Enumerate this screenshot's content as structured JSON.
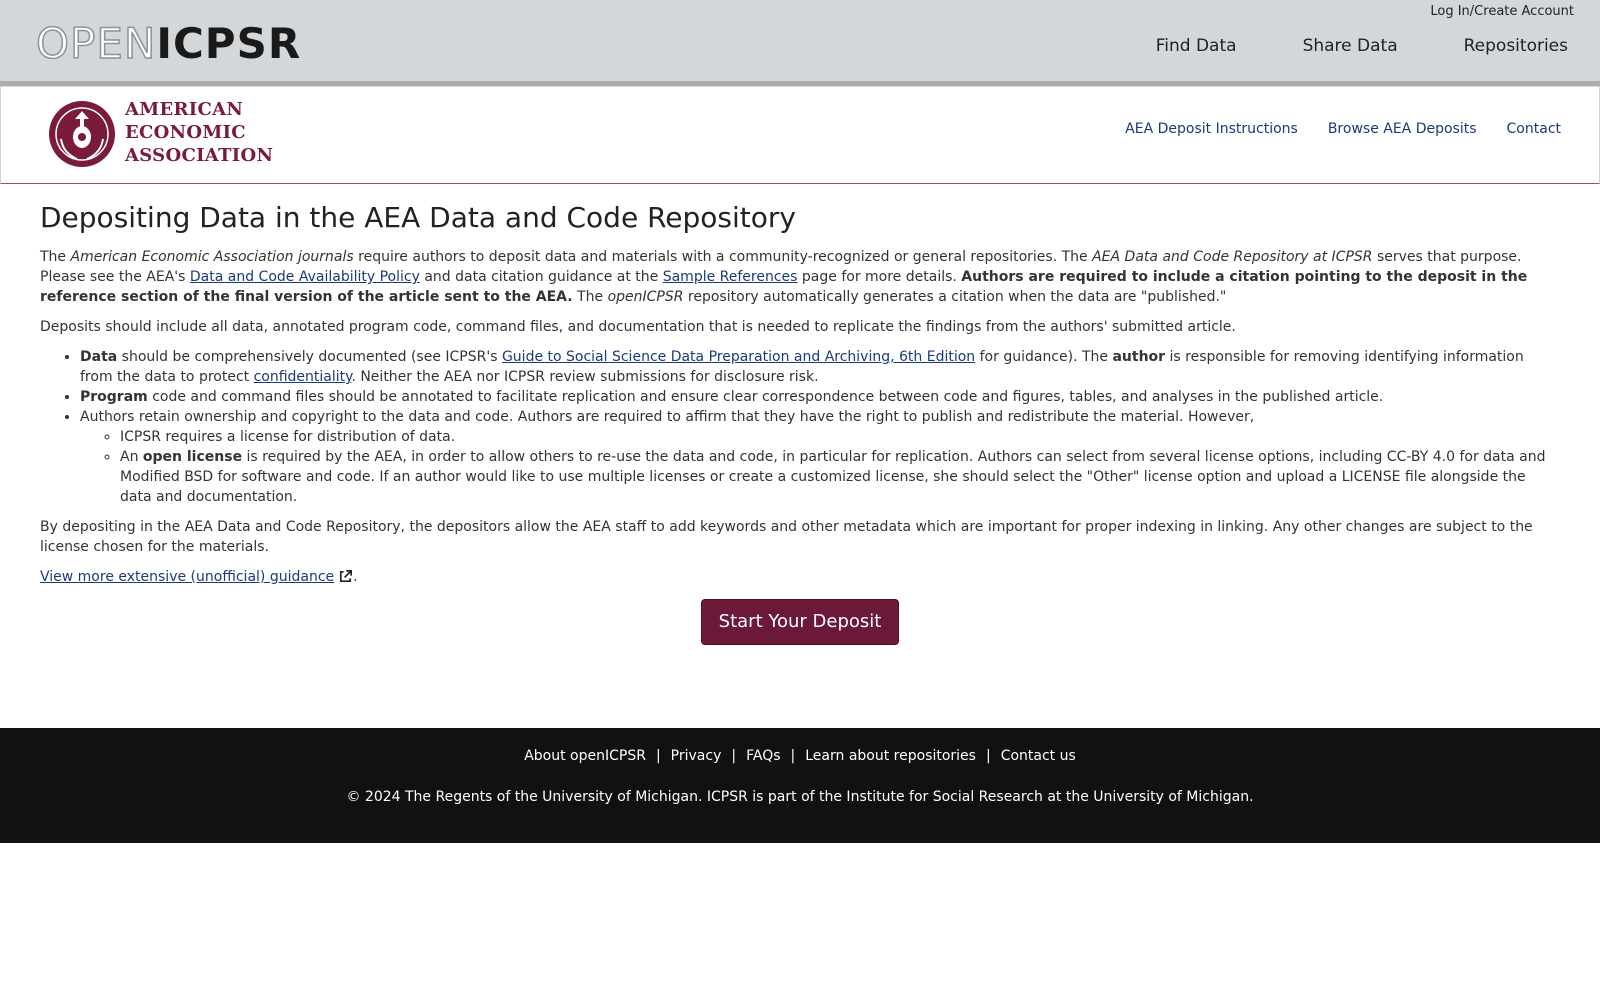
{
  "header": {
    "brand_open": "OPEN",
    "brand_icpsr": "ICPSR",
    "login": "Log In/Create Account",
    "nav": [
      "Find Data",
      "Share Data",
      "Repositories"
    ]
  },
  "aea": {
    "name_lines": [
      "AMERICAN",
      "ECONOMIC",
      "ASSOCIATION"
    ],
    "nav": [
      "AEA Deposit Instructions",
      "Browse AEA Deposits",
      "Contact"
    ],
    "colors": {
      "brand": "#7a1a3c",
      "link": "#1b3a7a"
    }
  },
  "main": {
    "title": "Depositing Data in the AEA Data and Code Repository",
    "p1": {
      "t1": "The ",
      "i1": "American Economic Association journals",
      "t2": " require authors to deposit data and materials with a community-recognized or general repositories. The ",
      "i2": "AEA Data and Code Repository at ICPSR",
      "t3": " serves that purpose. Please see the AEA's ",
      "link1": "Data and Code Availability Policy",
      "t4": " and data citation guidance at the ",
      "link2": "Sample References",
      "t5": " page for more details. ",
      "bold": "Authors are required to include a citation pointing to the deposit in the reference section of the final version of the article sent to the AEA.",
      "t6": " The ",
      "i3": "openICPSR",
      "t7": " repository automatically generates a citation when the data are \"published.\""
    },
    "p2": "Deposits should include all data, annotated program code, command files, and documentation that is needed to replicate the findings from the authors' submitted article.",
    "li1": {
      "b1": "Data",
      "t1": " should be comprehensively documented (see ICPSR's ",
      "link": "Guide to Social Science Data Preparation and Archiving, 6th Edition",
      "t2": " for guidance). The ",
      "b2": "author",
      "t3": " is responsible for removing identifying information from the data to protect ",
      "link2": "confidentiality",
      "t4": ". Neither the AEA nor ICPSR review submissions for disclosure risk."
    },
    "li2": {
      "b": "Program",
      "t": " code and command files should be annotated to facilitate replication and ensure clear correspondence between code and figures, tables, and analyses in the published article."
    },
    "li3": {
      "t": "Authors retain ownership and copyright to the data and code. Authors are required to affirm that they have the right to publish and redistribute the material. However,",
      "sub1": "ICPSR requires a license for distribution of data.",
      "sub2_t1": "An ",
      "sub2_b": "open license",
      "sub2_t2": " is required by the AEA, in order to allow others to re-use the data and code, in particular for replication. Authors can select from several license options, including CC-BY 4.0 for data and Modified BSD for software and code. If an author would like to use multiple licenses or create a customized license, she should select the \"Other\" license option and upload a LICENSE file alongside the data and documentation."
    },
    "p3": "By depositing in the AEA Data and Code Repository, the depositors allow the AEA staff to add keywords and other metadata which are important for proper indexing in linking. Any other changes are subject to the license chosen for the materials.",
    "guidance_link": "View more extensive (unofficial) guidance",
    "guidance_icon": "external-link-icon",
    "guidance_end": ".",
    "button": "Start Your Deposit"
  },
  "footer": {
    "links": [
      "About openICPSR",
      "Privacy",
      "FAQs",
      "Learn about repositories",
      "Contact us"
    ],
    "separator": "|",
    "copyright": "© 2024 The Regents of the University of Michigan. ICPSR is part of the Institute for Social Research at the University of Michigan."
  }
}
